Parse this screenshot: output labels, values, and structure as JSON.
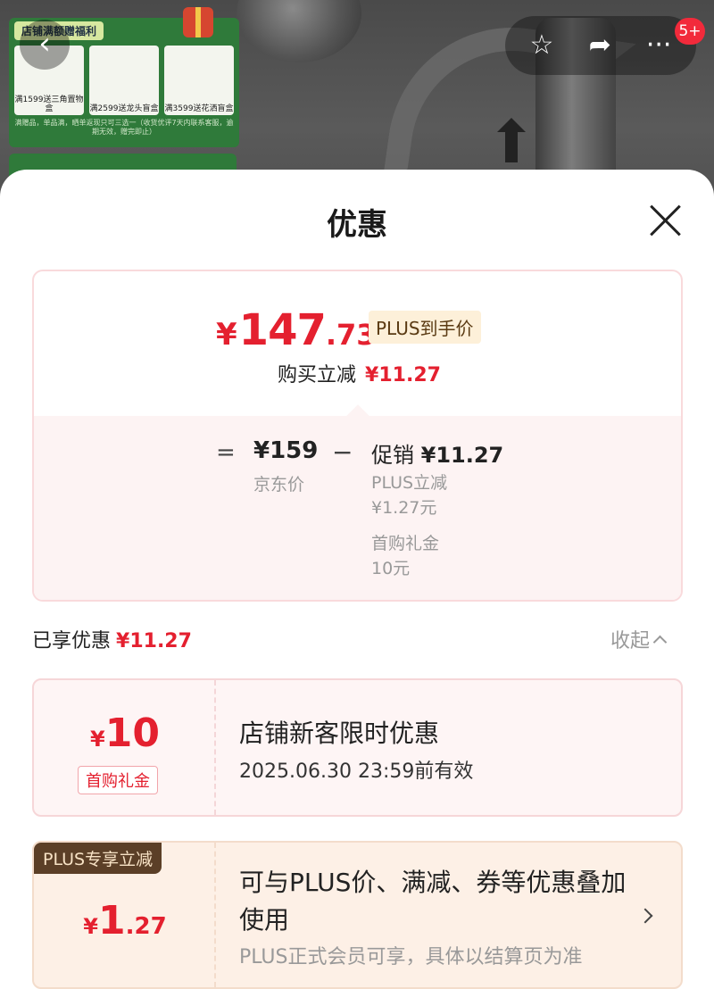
{
  "background": {
    "promo_title": "店铺满额赠福利",
    "promo_items": [
      "满1599送三角置物盒",
      "满2599送龙头盲盒",
      "满3599送花洒盲盒"
    ],
    "promo_note": "满赠品，单品满，晒单返现只可三选一（收货优评7天内联系客服，逾期无效，赠完即止）"
  },
  "topbar": {
    "back_icon": "chevron-left-icon",
    "favorite_icon": "star-icon",
    "share_icon": "share-icon",
    "more_icon": "more-icon",
    "message_badge": "5+"
  },
  "sheet": {
    "title": "优惠",
    "close_icon": "close-icon"
  },
  "price_summary": {
    "currency": "¥",
    "final_int": "147",
    "final_dec": ".73",
    "plus_tag": "PLUS到手价",
    "reduce_label": "购买立减",
    "reduce_value": "¥11.27",
    "equals": "=",
    "jd_price": "¥159",
    "jd_label": "京东价",
    "minus": "−",
    "promo_label": "促销",
    "promo_value": "¥11.27",
    "plus_reduce_label": "PLUS立减",
    "plus_reduce_value": "¥1.27元",
    "first_gift_label": "首购礼金",
    "first_gift_value": "10元"
  },
  "enjoyed": {
    "label": "已享优惠",
    "value": "¥11.27",
    "collapse_label": "收起"
  },
  "coupons": [
    {
      "currency": "¥",
      "amount": "10",
      "tag": "首购礼金",
      "title": "店铺新客限时优惠",
      "validity": "2025.06.30 23:59前有效"
    },
    {
      "badge": "PLUS专享立减",
      "currency": "¥",
      "amount_int": "1",
      "amount_dec": ".27",
      "title": "可与PLUS价、满减、券等优惠叠加使用",
      "desc": "PLUS正式会员可享，具体以结算页为准"
    }
  ],
  "colors": {
    "accent_red": "#e4202f",
    "plus_tag_bg": "#fdf0d9",
    "plus_badge_bg": "#5b3f27"
  }
}
